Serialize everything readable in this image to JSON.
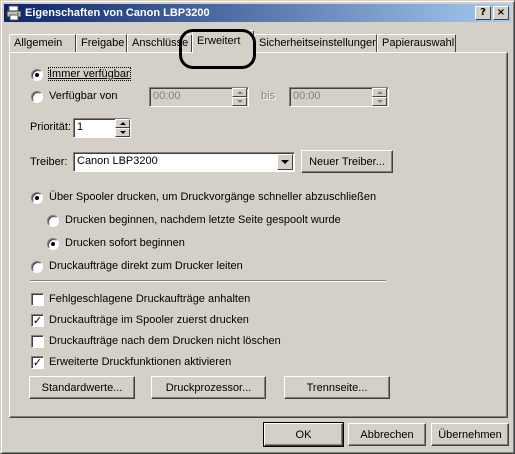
{
  "window": {
    "title": "Eigenschaften von Canon LBP3200",
    "help_btn": "?",
    "close_btn": "×"
  },
  "tabs": [
    "Allgemein",
    "Freigabe",
    "Anschlüsse",
    "Erweitert",
    "Sicherheitseinstellungen",
    "Papierauswahl"
  ],
  "availability": {
    "always": "Immer verfügbar",
    "from": "Verfügbar von",
    "from_time": "00:00",
    "to_label": "bis",
    "to_time": "00:00"
  },
  "priority": {
    "label": "Priorität:",
    "value": "1"
  },
  "driver": {
    "label": "Treiber:",
    "value": "Canon LBP3200",
    "new_button": "Neuer Treiber..."
  },
  "spool": {
    "use_spooler": "Über Spooler drucken, um Druckvorgänge schneller abzuschließen",
    "start_after_last": "Drucken beginnen, nachdem letzte Seite gespoolt wurde",
    "start_immediately": "Drucken sofort beginnen",
    "direct": "Druckaufträge direkt zum Drucker leiten"
  },
  "options": [
    {
      "label": "Fehlgeschlagene Druckaufträge anhalten",
      "checked": false
    },
    {
      "label": "Druckaufträge im Spooler zuerst drucken",
      "checked": true
    },
    {
      "label": "Druckaufträge nach dem Drucken nicht löschen",
      "checked": false
    },
    {
      "label": "Erweiterte Druckfunktionen aktivieren",
      "checked": true
    }
  ],
  "panel_buttons": {
    "defaults": "Standardwerte...",
    "processor": "Druckprozessor...",
    "separator": "Trennseite..."
  },
  "dialog_buttons": {
    "ok": "OK",
    "cancel": "Abbrechen",
    "apply": "Übernehmen"
  },
  "check_mark": "✓"
}
